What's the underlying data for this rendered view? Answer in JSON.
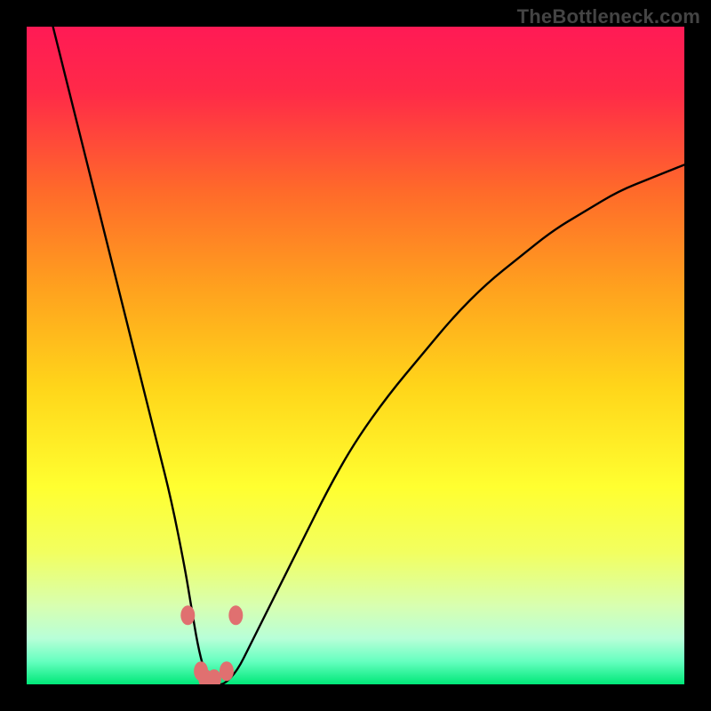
{
  "watermark": "TheBottleneck.com",
  "chart_data": {
    "type": "line",
    "title": "",
    "xlabel": "",
    "ylabel": "",
    "xlim": [
      0,
      100
    ],
    "ylim": [
      0,
      100
    ],
    "grid": false,
    "legend": false,
    "series": [
      {
        "name": "bottleneck-curve",
        "color": "#000000",
        "x": [
          4,
          6,
          8,
          10,
          12,
          14,
          16,
          18,
          20,
          22,
          24,
          25,
          26,
          27,
          28,
          29,
          30,
          32,
          34,
          38,
          42,
          46,
          50,
          55,
          60,
          65,
          70,
          75,
          80,
          85,
          90,
          95,
          100
        ],
        "y": [
          100,
          92,
          84,
          76,
          68,
          60,
          52,
          44,
          36,
          28,
          18,
          12,
          6,
          2,
          0,
          0,
          0,
          2,
          6,
          14,
          22,
          30,
          37,
          44,
          50,
          56,
          61,
          65,
          69,
          72,
          75,
          77,
          79
        ]
      },
      {
        "name": "highlight-dots",
        "color": "#e07070",
        "type": "scatter",
        "x": [
          24.5,
          26.5,
          27.2,
          28.5,
          30.4,
          31.8
        ],
        "y": [
          10.5,
          2.0,
          0.8,
          0.8,
          2.0,
          10.5
        ]
      }
    ],
    "gradient_stops": [
      {
        "offset": 0.0,
        "color": "#ff1a55"
      },
      {
        "offset": 0.1,
        "color": "#ff2a48"
      },
      {
        "offset": 0.25,
        "color": "#ff6a2a"
      },
      {
        "offset": 0.4,
        "color": "#ffa21e"
      },
      {
        "offset": 0.55,
        "color": "#ffd61a"
      },
      {
        "offset": 0.7,
        "color": "#ffff30"
      },
      {
        "offset": 0.8,
        "color": "#f2ff60"
      },
      {
        "offset": 0.88,
        "color": "#d8ffb0"
      },
      {
        "offset": 0.93,
        "color": "#b8ffd8"
      },
      {
        "offset": 0.965,
        "color": "#66ffc0"
      },
      {
        "offset": 1.0,
        "color": "#00e878"
      }
    ]
  }
}
